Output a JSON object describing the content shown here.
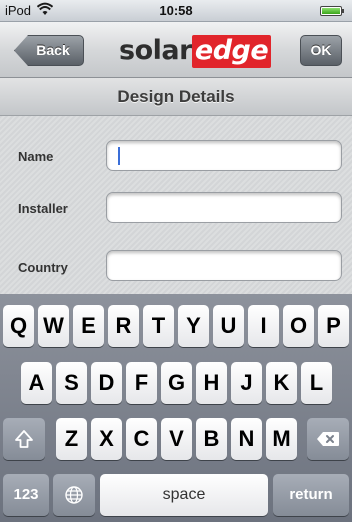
{
  "status_bar": {
    "device": "iPod",
    "time": "10:58"
  },
  "nav": {
    "back_label": "Back",
    "logo_part1": "solar",
    "logo_part2": "edge",
    "ok_label": "OK"
  },
  "section": {
    "title": "Design Details"
  },
  "form": {
    "fields": [
      {
        "label": "Name",
        "value": ""
      },
      {
        "label": "Installer",
        "value": ""
      },
      {
        "label": "Country",
        "value": ""
      }
    ]
  },
  "keyboard": {
    "row1": [
      "Q",
      "W",
      "E",
      "R",
      "T",
      "Y",
      "U",
      "I",
      "O",
      "P"
    ],
    "row2": [
      "A",
      "S",
      "D",
      "F",
      "G",
      "H",
      "J",
      "K",
      "L"
    ],
    "row3": [
      "Z",
      "X",
      "C",
      "V",
      "B",
      "N",
      "M"
    ],
    "numbers_label": "123",
    "space_label": "space",
    "return_label": "return"
  },
  "colors": {
    "brand_red": "#e1252b",
    "cursor_blue": "#3a6ed8"
  }
}
